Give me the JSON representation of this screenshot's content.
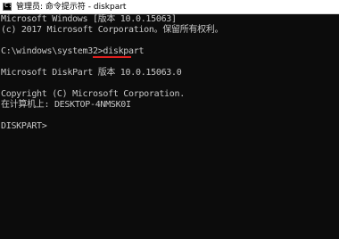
{
  "window": {
    "title": "管理员: 命令提示符 - diskpart",
    "icon": "cmd-icon",
    "icon_glyph": "C:\\"
  },
  "console": {
    "lines": [
      "Microsoft Windows [版本 10.0.15063]",
      "(c) 2017 Microsoft Corporation。保留所有权利。",
      "",
      "C:\\windows\\system32>diskpart",
      "",
      "Microsoft DiskPart 版本 10.0.15063.0",
      "",
      "Copyright (C) Microsoft Corporation.",
      "在计算机上: DESKTOP-4NMSK0I",
      "",
      "DISKPART>"
    ],
    "text_color": "#c8c8c8",
    "background": "#0c0c0c",
    "highlight_color": "#e0201f"
  }
}
